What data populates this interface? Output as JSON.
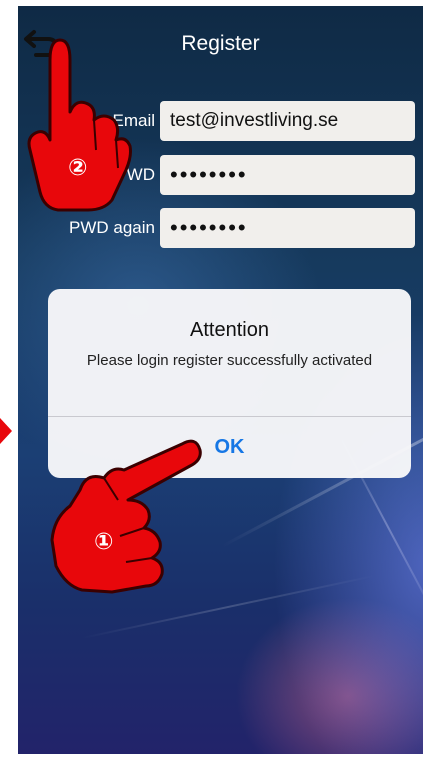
{
  "header": {
    "title": "Register",
    "back_icon": "back-arrow-icon"
  },
  "form": {
    "email": {
      "label": "Email",
      "value": "test@investliving.se"
    },
    "pwd": {
      "label": "PWD",
      "value": "••••••••"
    },
    "pwd_again": {
      "label": "PWD again",
      "value": "••••••••"
    }
  },
  "alert": {
    "title": "Attention",
    "message": "Please login register successfully activated",
    "ok_label": "OK"
  },
  "annotations": {
    "step1": "①",
    "step2": "②",
    "hand_color": "#e8070b"
  }
}
